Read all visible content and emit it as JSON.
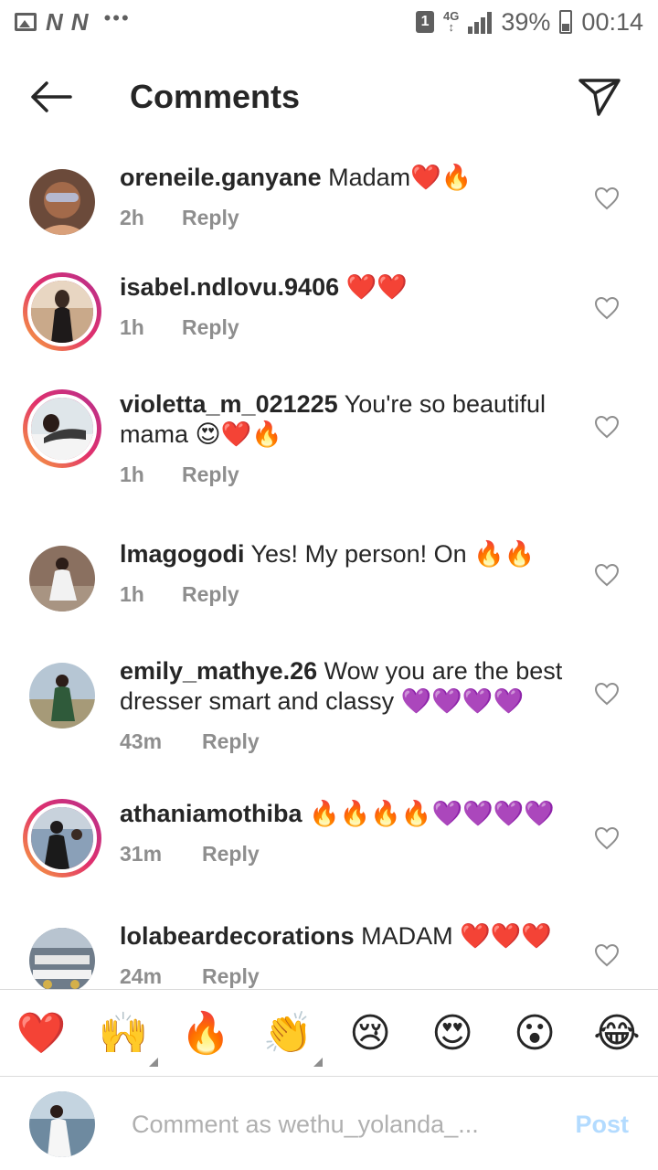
{
  "status_bar": {
    "sim_slot": "1",
    "network": "4G",
    "battery": "39%",
    "time": "00:14",
    "left_icons": [
      "image-icon",
      "n-notification-icon",
      "n-notification-icon",
      "more-dots-icon"
    ]
  },
  "header": {
    "title": "Comments",
    "back_icon": "arrow-left-icon",
    "share_icon": "paper-plane-icon"
  },
  "comments": [
    {
      "username": "oreneile.ganyane",
      "text": "Madam❤️🔥",
      "time": "2h",
      "reply": "Reply",
      "story_ring": false
    },
    {
      "username": "isabel.ndlovu.9406",
      "text": "❤️❤️",
      "time": "1h",
      "reply": "Reply",
      "story_ring": true
    },
    {
      "username": "violetta_m_021225",
      "text": "You're so beautiful mama 😍❤️🔥",
      "time": "1h",
      "reply": "Reply",
      "story_ring": true
    },
    {
      "username": "lmagogodi",
      "text": "Yes! My person! On 🔥🔥",
      "time": "1h",
      "reply": "Reply",
      "story_ring": false
    },
    {
      "username": "emily_mathye.26",
      "text": "Wow you are the best dresser smart and classy 💜💜💜💜",
      "time": "43m",
      "reply": "Reply",
      "story_ring": false
    },
    {
      "username": "athaniamothiba",
      "text": "🔥🔥🔥🔥💜💜💜💜",
      "time": "31m",
      "reply": "Reply",
      "story_ring": true
    },
    {
      "username": "lolabeardecorations",
      "text": "MADAM ❤️❤️❤️",
      "time": "24m",
      "reply": "Reply",
      "story_ring": false
    }
  ],
  "emoji_bar": [
    "❤️",
    "🙌",
    "🔥",
    "👏",
    "😢",
    "😍",
    "😮",
    "😂"
  ],
  "input": {
    "placeholder": "Comment as wethu_yolanda_...",
    "post_label": "Post"
  },
  "colors": {
    "text": "#262626",
    "meta": "#8e8e8e",
    "post_disabled": "#b3dbff",
    "story_ring_start": "#f9a93a",
    "story_ring_end": "#b52f8f"
  }
}
